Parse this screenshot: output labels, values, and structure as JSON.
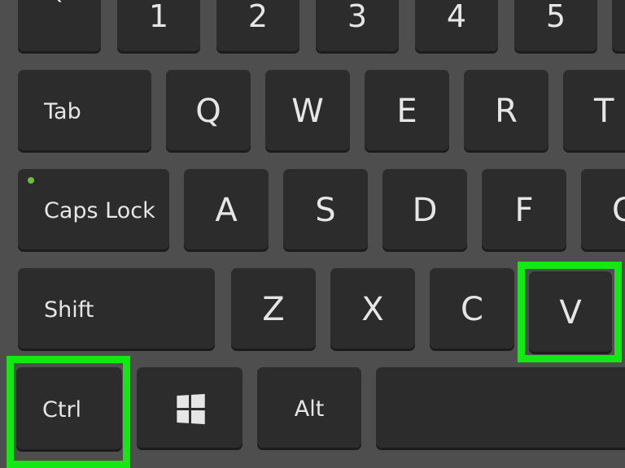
{
  "keyboard": {
    "row_numbers": [
      "`",
      "1",
      "2",
      "3",
      "4",
      "5"
    ],
    "row_qwerty": [
      "Tab",
      "Q",
      "W",
      "E",
      "R",
      "T"
    ],
    "row_home": [
      "Caps Lock",
      "A",
      "S",
      "D",
      "F",
      "G"
    ],
    "row_shift": [
      "Shift",
      "Z",
      "X",
      "C",
      "V"
    ],
    "row_bottom": {
      "ctrl": "Ctrl",
      "win": "windows-logo",
      "alt": "Alt",
      "space": ""
    },
    "highlighted_keys": [
      "Ctrl",
      "V"
    ]
  },
  "colors": {
    "background": "#4e4e4e",
    "key": "#2c2c2c",
    "label": "#e6e6e6",
    "highlight": "#14e814",
    "caps_led": "#6fbf3a"
  },
  "icons": {
    "win": "windows-logo-icon"
  }
}
